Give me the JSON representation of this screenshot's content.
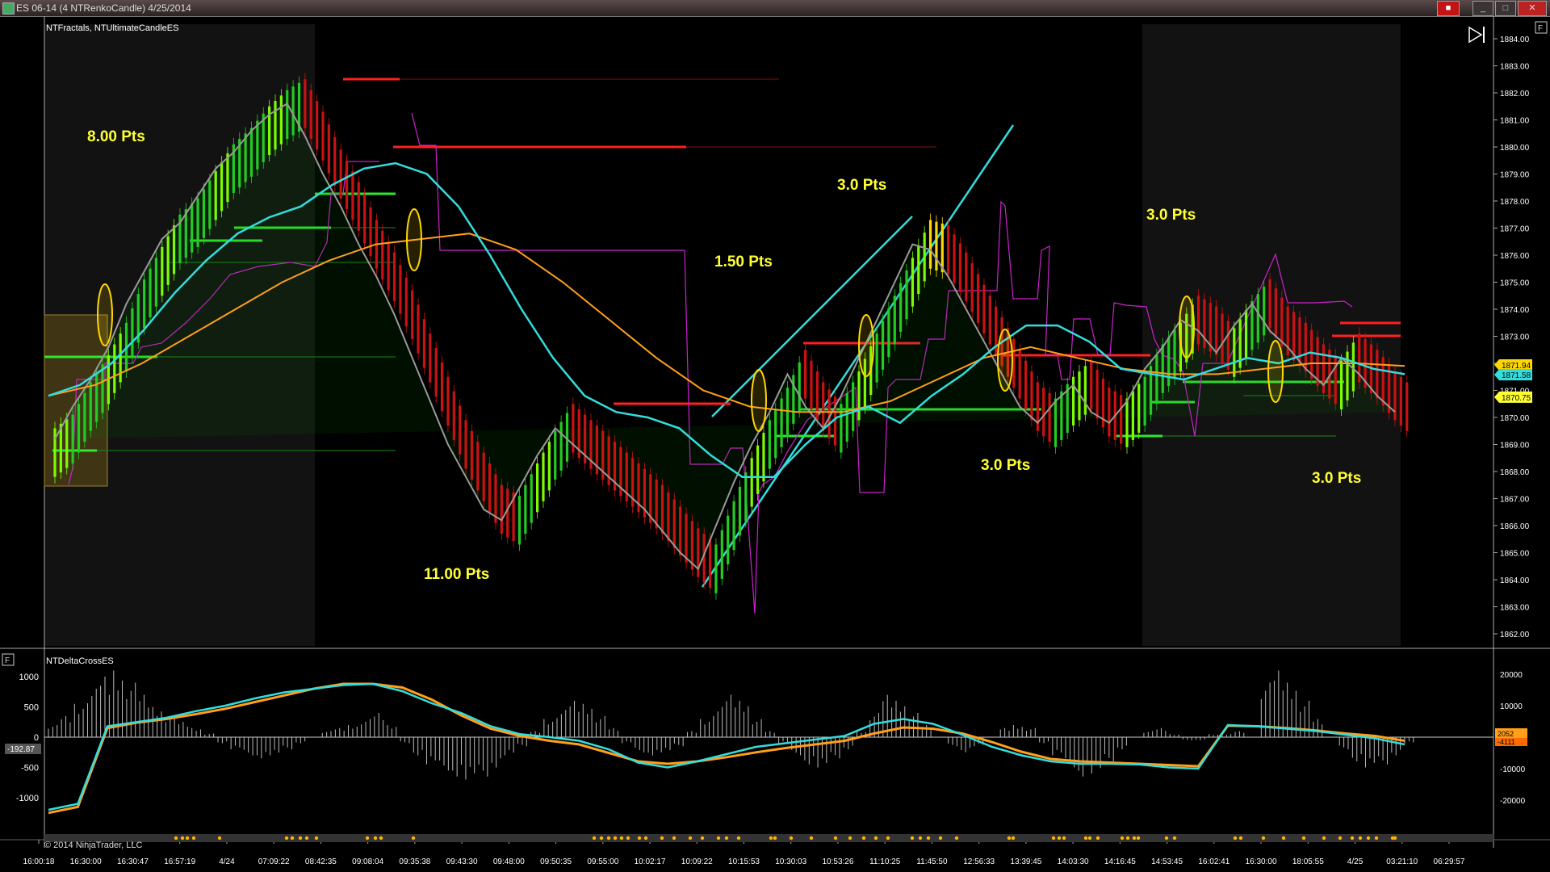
{
  "window": {
    "title": "ES 06-14 (4 NTRenkoCandle)  4/25/2014",
    "buttons": [
      "_",
      "□",
      "✕"
    ],
    "record_indicator": "■"
  },
  "colors": {
    "background": "#000000",
    "session_shade": "#121212",
    "up_bar": "#22cc22",
    "up_bar_bright": "#7cfc00",
    "down_bar": "#cc1111",
    "neutral_bar": "#ffd700",
    "cyan_line": "#33dddd",
    "orange_line": "#ff9f1a",
    "grey_line": "#9a9a9a",
    "magenta_line": "#cc22cc",
    "pts_text": "#ffff33",
    "axis_text": "#ffffff"
  },
  "chart_data": [
    {
      "type": "candlestick",
      "label": "NTFractals, NTUltimateCandleES",
      "y_range": [
        1861.5,
        1884.3
      ],
      "y_ticks": [
        "1884.00",
        "1883.00",
        "1882.00",
        "1881.00",
        "1880.00",
        "1879.00",
        "1878.00",
        "1877.00",
        "1876.00",
        "1875.00",
        "1874.00",
        "1873.00",
        "1872.00",
        "1871.00",
        "1870.00",
        "1869.00",
        "1868.00",
        "1867.00",
        "1866.00",
        "1865.00",
        "1864.00",
        "1863.00",
        "1862.00"
      ],
      "price_markers": [
        {
          "label": "1871.94",
          "value": 1871.94,
          "color": "#ffd700"
        },
        {
          "label": "1871.58",
          "value": 1871.58,
          "color": "#33dddd"
        },
        {
          "label": "1870.75",
          "value": 1870.75,
          "color": "#ffff33"
        }
      ],
      "x_time_labels": [
        "16:00:18",
        "16:30:00",
        "16:30:47",
        "16:57:19",
        "4/24",
        "07:09:22",
        "08:42:35",
        "09:08:04",
        "09:35:38",
        "09:43:30",
        "09:48:00",
        "09:50:35",
        "09:55:00",
        "10:02:17",
        "10:09:22",
        "10:15:53",
        "10:30:03",
        "10:53:26",
        "11:10:25",
        "11:45:50",
        "12:56:33",
        "13:39:45",
        "14:03:30",
        "14:16:45",
        "14:53:45",
        "16:02:41",
        "16:30:00",
        "18:05:55",
        "4/25",
        "03:21:10",
        "06:29:57"
      ],
      "close_path": [
        1869.2,
        1870.4,
        1871.4,
        1872.6,
        1874.2,
        1875.4,
        1876.6,
        1877.2,
        1878.2,
        1879.2,
        1879.8,
        1880.6,
        1881.2,
        1881.6,
        1880.4,
        1879.0,
        1877.8,
        1876.4,
        1875.2,
        1873.8,
        1872.2,
        1870.6,
        1869.0,
        1867.8,
        1866.6,
        1866.2,
        1867.4,
        1868.6,
        1869.6,
        1869.0,
        1868.4,
        1867.8,
        1867.2,
        1866.6,
        1865.8,
        1865.0,
        1864.4,
        1866.0,
        1867.6,
        1869.0,
        1870.2,
        1871.6,
        1870.4,
        1869.6,
        1870.8,
        1872.2,
        1873.6,
        1875.0,
        1876.4,
        1876.2,
        1875.2,
        1874.0,
        1872.8,
        1871.6,
        1870.4,
        1869.8,
        1870.6,
        1871.2,
        1870.2,
        1869.8,
        1870.6,
        1871.8,
        1872.6,
        1873.6,
        1873.2,
        1872.4,
        1873.4,
        1874.2,
        1873.2,
        1872.6,
        1871.8,
        1871.2,
        1872.2,
        1871.6,
        1870.8,
        1870.2
      ],
      "cyan_ma": [
        1870.8,
        1871.2,
        1872.0,
        1873.2,
        1874.6,
        1875.8,
        1876.8,
        1877.4,
        1877.8,
        1878.6,
        1879.2,
        1879.4,
        1879.0,
        1877.8,
        1876.0,
        1874.0,
        1872.2,
        1870.8,
        1870.2,
        1870.0,
        1869.6,
        1868.6,
        1867.8,
        1867.8,
        1869.0,
        1870.0,
        1870.4,
        1869.8,
        1870.8,
        1871.6,
        1872.6,
        1873.4,
        1873.4,
        1872.8,
        1871.8,
        1871.6,
        1871.4,
        1871.8,
        1872.2,
        1872.0,
        1872.4,
        1872.2,
        1871.8,
        1871.6
      ],
      "orange_ma": [
        1870.8,
        1871.2,
        1872.0,
        1873.0,
        1874.0,
        1875.0,
        1875.8,
        1876.4,
        1876.6,
        1876.8,
        1876.2,
        1875.0,
        1873.6,
        1872.2,
        1871.0,
        1870.4,
        1870.2,
        1870.2,
        1870.6,
        1871.4,
        1872.2,
        1872.6,
        1872.2,
        1871.8,
        1871.6,
        1871.6,
        1871.8,
        1872.0,
        1872.0,
        1871.9
      ],
      "annotations": [
        "8.00 Pts",
        "11.00 Pts",
        "1.50 Pts",
        "3.0 Pts",
        "3.0 Pts",
        "3.0 Pts",
        "3.0 Pts"
      ]
    },
    {
      "type": "bar",
      "label": "NTDeltaCrossES",
      "y_range_left": [
        -1300,
        1200
      ],
      "y_ticks_left": [
        "1000",
        "500",
        "0",
        "-500",
        "-1000"
      ],
      "y_ticks_right": [
        "20000",
        "10000",
        "0",
        "-10000",
        "-20000"
      ],
      "current_value_label": "-192.87",
      "right_value_labels": [
        "-4111",
        "2052"
      ],
      "histogram": [
        200,
        350,
        550,
        800,
        1000,
        1100,
        900,
        700,
        500,
        350,
        250,
        150,
        60,
        -100,
        -200,
        -300,
        -350,
        -300,
        -200,
        -100,
        0,
        100,
        150,
        200,
        300,
        400,
        200,
        -100,
        -300,
        -450,
        -550,
        -650,
        -700,
        -650,
        -500,
        -300,
        -150,
        100,
        300,
        450,
        600,
        550,
        350,
        150,
        -100,
        -250,
        -300,
        -250,
        -150,
        100,
        300,
        500,
        700,
        600,
        300,
        100,
        -100,
        -300,
        -450,
        -500,
        -350,
        -200,
        100,
        400,
        700,
        600,
        400,
        200,
        0,
        -150,
        -250,
        -150,
        0,
        150,
        200,
        150,
        -100,
        -300,
        -500,
        -650,
        -600,
        -400,
        -200,
        0,
        100,
        150,
        50,
        -50,
        -50,
        50,
        50,
        100,
        0,
        900,
        1100,
        900,
        600,
        300,
        0,
        -200,
        -400,
        -500,
        -450,
        -300,
        -100
      ],
      "cyan_line": [
        -1200,
        -1100,
        180,
        250,
        320,
        430,
        520,
        640,
        740,
        800,
        860,
        880,
        760,
        560,
        400,
        180,
        50,
        0,
        -60,
        -200,
        -420,
        -500,
        -400,
        -280,
        -160,
        -100,
        -40,
        20,
        220,
        300,
        220,
        40,
        -160,
        -300,
        -400,
        -440,
        -440,
        -450,
        -500,
        -520,
        200,
        180,
        140,
        100,
        40,
        -20,
        -120
      ],
      "orange_line": [
        -1250,
        -1150,
        150,
        240,
        300,
        380,
        470,
        580,
        690,
        800,
        880,
        880,
        820,
        620,
        360,
        140,
        20,
        -60,
        -120,
        -260,
        -400,
        -440,
        -400,
        -330,
        -250,
        -180,
        -120,
        -60,
        60,
        160,
        140,
        60,
        -80,
        -240,
        -360,
        -400,
        -420,
        -440,
        -460,
        -480,
        190,
        180,
        150,
        110,
        60,
        20,
        -60
      ]
    }
  ],
  "copyright": "© 2014 NinjaTrader, LLC",
  "panel_tags": {
    "main": "F",
    "lower": "F"
  }
}
